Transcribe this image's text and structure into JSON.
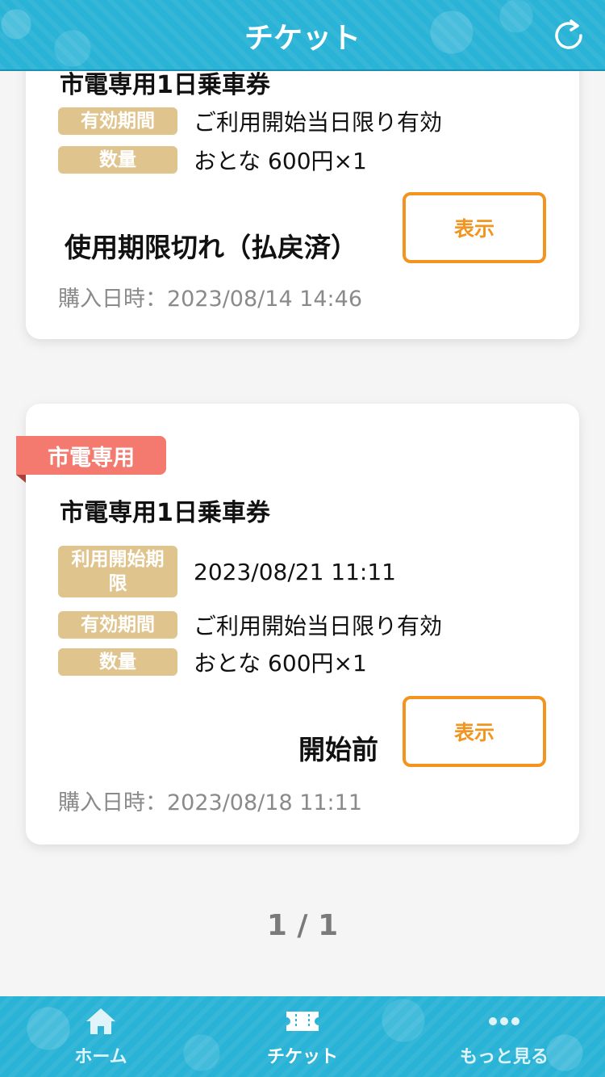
{
  "header": {
    "title": "チケット"
  },
  "cards": [
    {
      "title": "市電専用1日乗車券",
      "rows": [
        {
          "label": "有効期間",
          "value": "ご利用開始当日限り有効"
        },
        {
          "label": "数量",
          "value": "おとな 600円×1"
        }
      ],
      "status": "使用期限切れ（払戻済）",
      "button": "表示",
      "purchase": "購入日時：2023/08/14 14:46"
    },
    {
      "ribbon": "市電専用",
      "title": "市電専用1日乗車券",
      "rows": [
        {
          "label": "利用開始期限",
          "value": "2023/08/21 11:11"
        },
        {
          "label": "有効期間",
          "value": "ご利用開始当日限り有効"
        },
        {
          "label": "数量",
          "value": "おとな 600円×1"
        }
      ],
      "status": "開始前",
      "button": "表示",
      "purchase": "購入日時：2023/08/18 11:11"
    }
  ],
  "pager": {
    "text": "1 / 1"
  },
  "footer": {
    "items": [
      {
        "label": "ホーム",
        "icon": "home-icon"
      },
      {
        "label": "チケット",
        "icon": "ticket-icon"
      },
      {
        "label": "もっと見る",
        "icon": "more-icon"
      }
    ]
  },
  "colors": {
    "header_bg": "#29b3d6",
    "tag_bg": "#e0c48d",
    "button_accent": "#f2941f",
    "ribbon_bg": "#f4796f"
  }
}
